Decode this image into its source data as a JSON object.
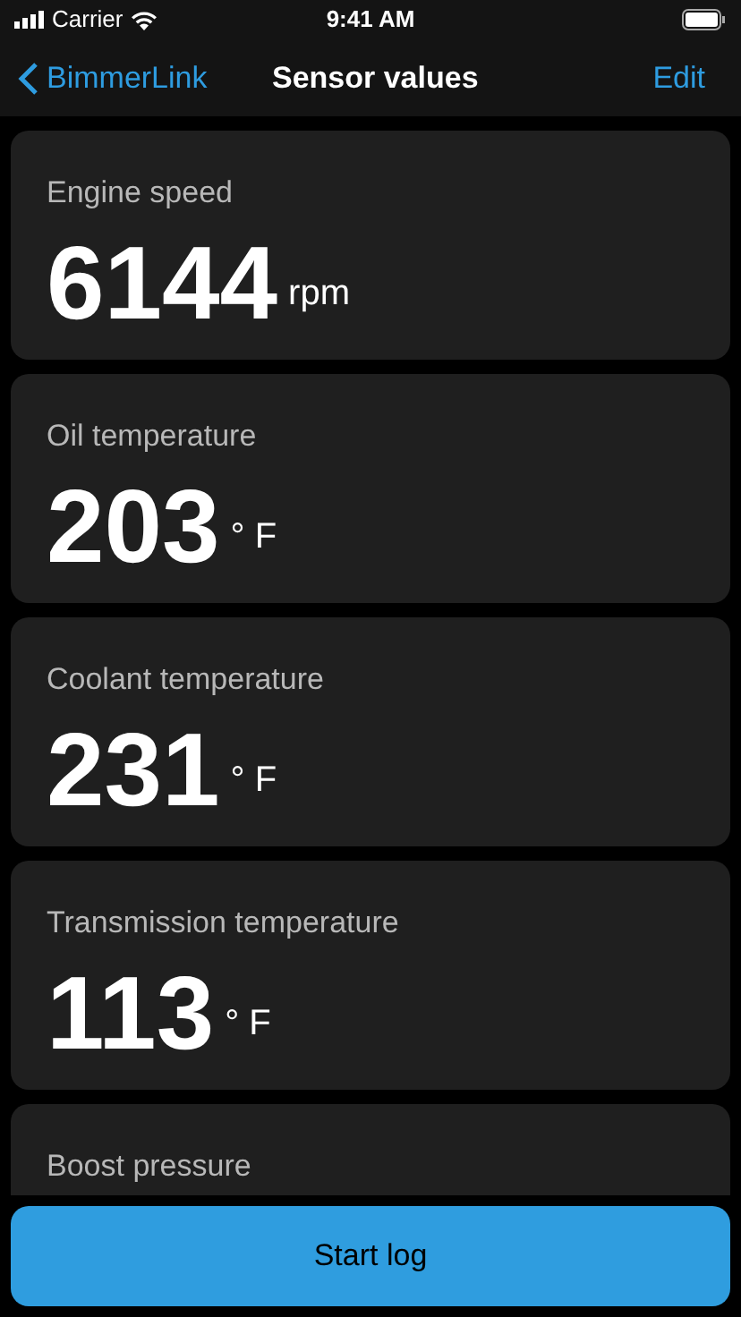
{
  "status_bar": {
    "carrier": "Carrier",
    "time": "9:41 AM"
  },
  "nav": {
    "back": "BimmerLink",
    "title": "Sensor values",
    "action": "Edit"
  },
  "sensors": [
    {
      "label": "Engine speed",
      "value": "6144",
      "unit": "rpm"
    },
    {
      "label": "Oil temperature",
      "value": "203",
      "unit": "° F"
    },
    {
      "label": "Coolant temperature",
      "value": "231",
      "unit": "° F"
    },
    {
      "label": "Transmission temperature",
      "value": "113",
      "unit": "° F"
    },
    {
      "label": "Boost pressure"
    }
  ],
  "button": "Start log"
}
